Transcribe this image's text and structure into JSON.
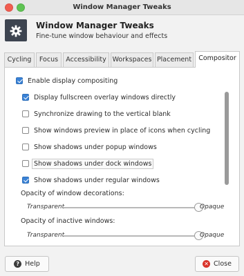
{
  "window": {
    "title": "Window Manager Tweaks"
  },
  "header": {
    "title": "Window Manager Tweaks",
    "subtitle": "Fine-tune window behaviour and effects",
    "icon": "settings-gear-icon"
  },
  "tabs": [
    {
      "label": "Cycling",
      "active": false
    },
    {
      "label": "Focus",
      "active": false
    },
    {
      "label": "Accessibility",
      "active": false
    },
    {
      "label": "Workspaces",
      "active": false
    },
    {
      "label": "Placement",
      "active": false
    },
    {
      "label": "Compositor",
      "active": true
    }
  ],
  "compositor": {
    "enable": {
      "label": "Enable display compositing",
      "checked": true
    },
    "options": [
      {
        "label": "Display fullscreen overlay windows directly",
        "checked": true
      },
      {
        "label": "Synchronize drawing to the vertical blank",
        "checked": false
      },
      {
        "label": "Show windows preview in place of icons when cycling",
        "checked": false
      },
      {
        "label": "Show shadows under popup windows",
        "checked": false
      },
      {
        "label": "Show shadows under dock windows",
        "checked": false
      },
      {
        "label": "Show shadows under regular windows",
        "checked": true
      }
    ],
    "decorations_opacity": {
      "label": "Opacity of window decorations:",
      "min_label": "Transparent",
      "max_label": "Opaque",
      "value": 1.0
    },
    "inactive_opacity": {
      "label": "Opacity of inactive windows:",
      "min_label": "Transparent",
      "max_label": "Opaque",
      "value": 1.0
    }
  },
  "buttons": {
    "help": "Help",
    "close": "Close"
  },
  "colors": {
    "accent": "#3a82d6",
    "close_button": "#f25d50",
    "maximize_button": "#5fc453"
  }
}
